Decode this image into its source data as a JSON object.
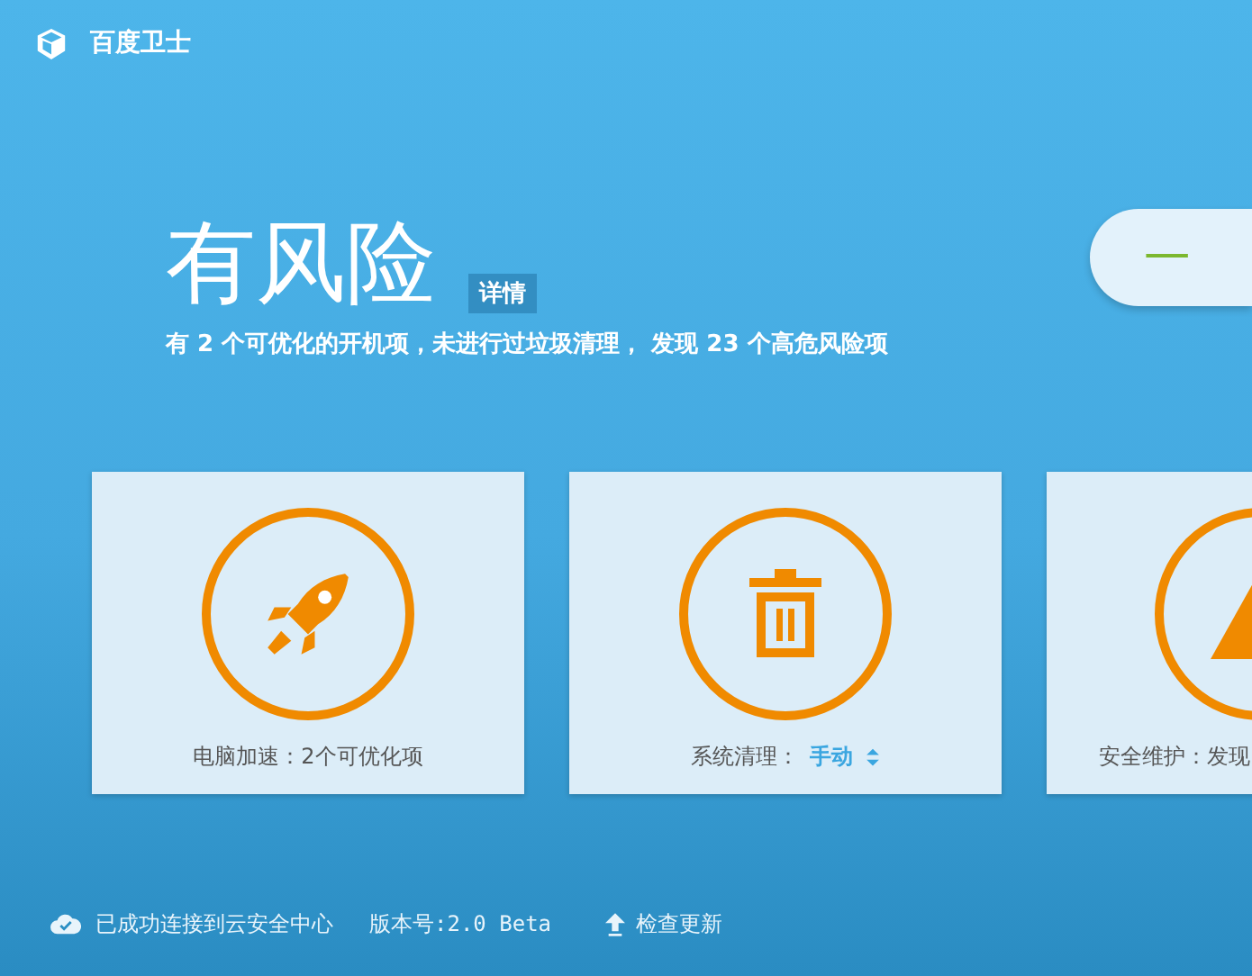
{
  "window": {
    "title": "百度卫士"
  },
  "status": {
    "headline": "有风险",
    "details_link": "详情",
    "summary": "有 2 个可优化的开机项，未进行过垃圾清理， 发现 23 个高危风险项"
  },
  "action_button": {
    "label": "一"
  },
  "cards": [
    {
      "kind": "speedup",
      "label": "电脑加速：2个可优化项"
    },
    {
      "kind": "cleanup",
      "label": "系统清理：",
      "value": "手动"
    },
    {
      "kind": "security",
      "label": "安全维护：发现"
    }
  ],
  "footer": {
    "connection": "已成功连接到云安全中心",
    "version": "版本号:2.0 Beta",
    "update_link": "检查更新"
  }
}
